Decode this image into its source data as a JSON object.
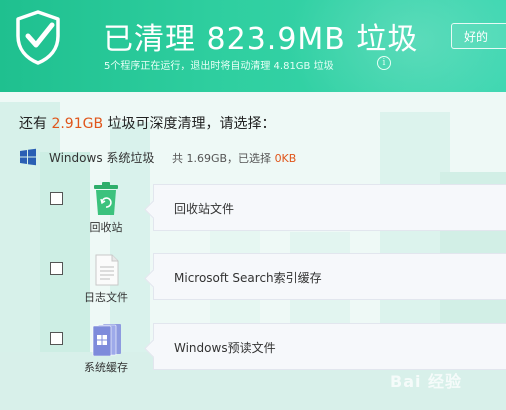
{
  "header": {
    "title": "已清理 823.9MB 垃圾",
    "subtitle": "5个程序正在运行，退出时将自动清理 4.81GB 垃圾",
    "info_icon": "i",
    "ok_label": "好的"
  },
  "prompt": {
    "prefix": "还有 ",
    "amount": "2.91GB",
    "suffix": " 垃圾可深度清理，请选择："
  },
  "group": {
    "icon": "windows-logo",
    "name": "Windows 系统垃圾",
    "stats_prefix": "共 1.69GB，已选择 ",
    "stats_selected": "0KB"
  },
  "items": [
    {
      "icon": "recycle-bin",
      "label": "回收站",
      "card_text": "回收站文件",
      "checked": false
    },
    {
      "icon": "log-file",
      "label": "日志文件",
      "card_text": "Microsoft Search索引缓存",
      "checked": false
    },
    {
      "icon": "system-cache",
      "label": "系统缓存",
      "card_text": "Windows预读文件",
      "checked": false
    }
  ],
  "watermark": "Bai 经验",
  "colors": {
    "header_green": "#2fcfa0",
    "highlight_orange": "#e0561b",
    "windows_blue": "#2b5fb4"
  }
}
